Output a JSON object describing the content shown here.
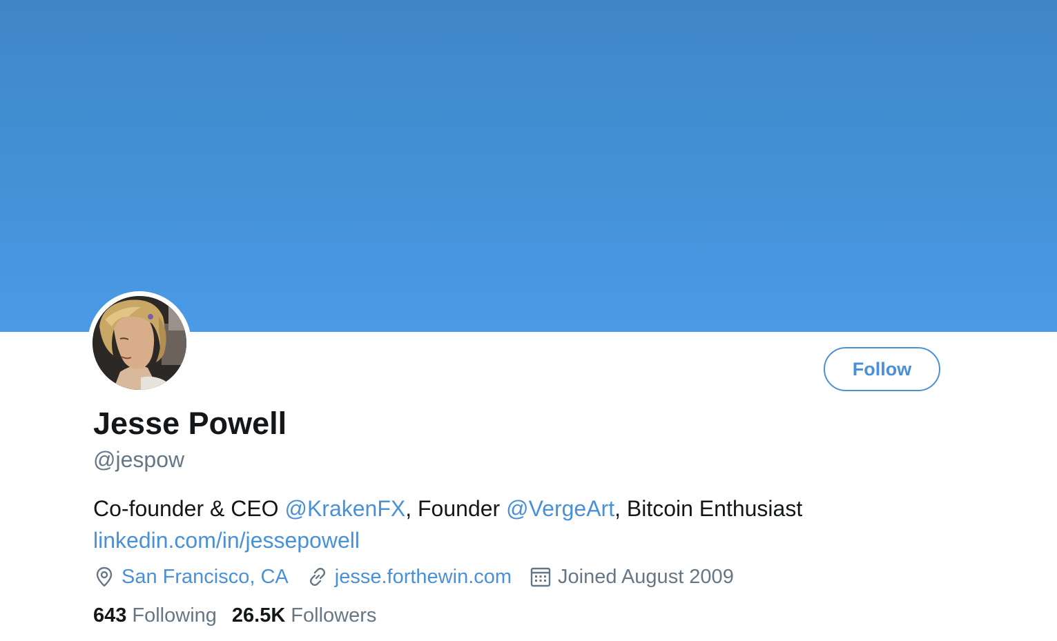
{
  "profile": {
    "name": "Jesse Powell",
    "handle": "@jespow",
    "follow_label": "Follow",
    "bio": {
      "line1_prefix": "Co-founder & CEO ",
      "mention1": "@KrakenFX",
      "line1_middle": ", Founder ",
      "mention2": "@VergeArt",
      "line1_suffix": ", Bitcoin Enthusiast",
      "line2_link": "linkedin.com/in/jessepowell"
    },
    "meta": {
      "location": "San Francisco, CA",
      "website": "jesse.forthewin.com",
      "joined": "Joined August 2009",
      "location_icon": "location-pin-icon",
      "website_icon": "link-icon",
      "joined_icon": "calendar-icon"
    },
    "stats": {
      "following_count": "643",
      "following_label": "Following",
      "followers_count": "26.5K",
      "followers_label": "Followers"
    }
  },
  "colors": {
    "banner_top": "#3f86c6",
    "banner_bottom": "#4a9ae6",
    "accent": "#4a90d9",
    "text_primary": "#14171a",
    "text_secondary": "#657786"
  }
}
